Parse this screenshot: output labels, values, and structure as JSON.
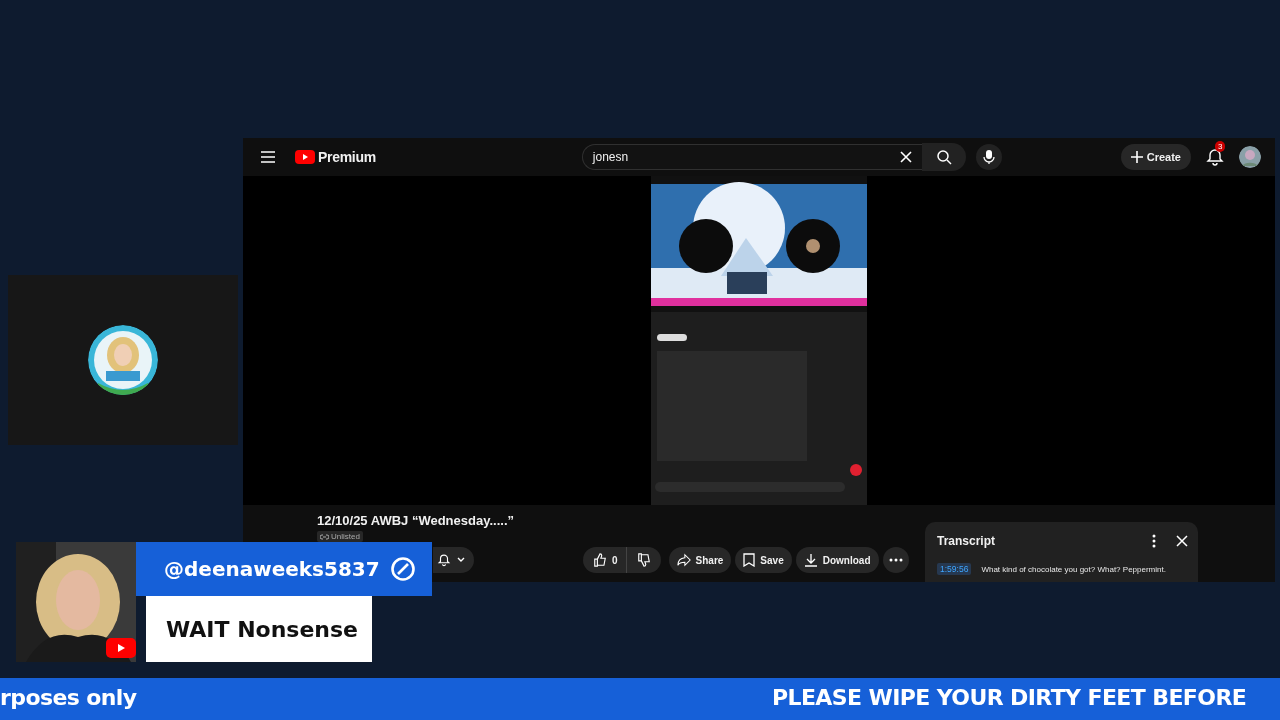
{
  "browser": {
    "brand": "Premium",
    "search": {
      "value": "jonesn"
    },
    "create_label": "Create",
    "notification_count": "3",
    "title": "12/10/25 AWBJ “Wednesday.....”",
    "visibility": "Unlisted",
    "actions": {
      "likes": "0",
      "share": "Share",
      "save": "Save",
      "download": "Download"
    }
  },
  "transcript": {
    "title": "Transcript",
    "entries": [
      {
        "time": "1:59:56",
        "text": "What kind of chocolate you got? What? Peppermint."
      }
    ]
  },
  "lower_third": {
    "handle": "@deenaweeks5837",
    "caption": "WAIT Nonsense"
  },
  "ticker": [
    "rposes only",
    "PLEASE WIPE YOUR DIRTY FEET BEFORE"
  ]
}
